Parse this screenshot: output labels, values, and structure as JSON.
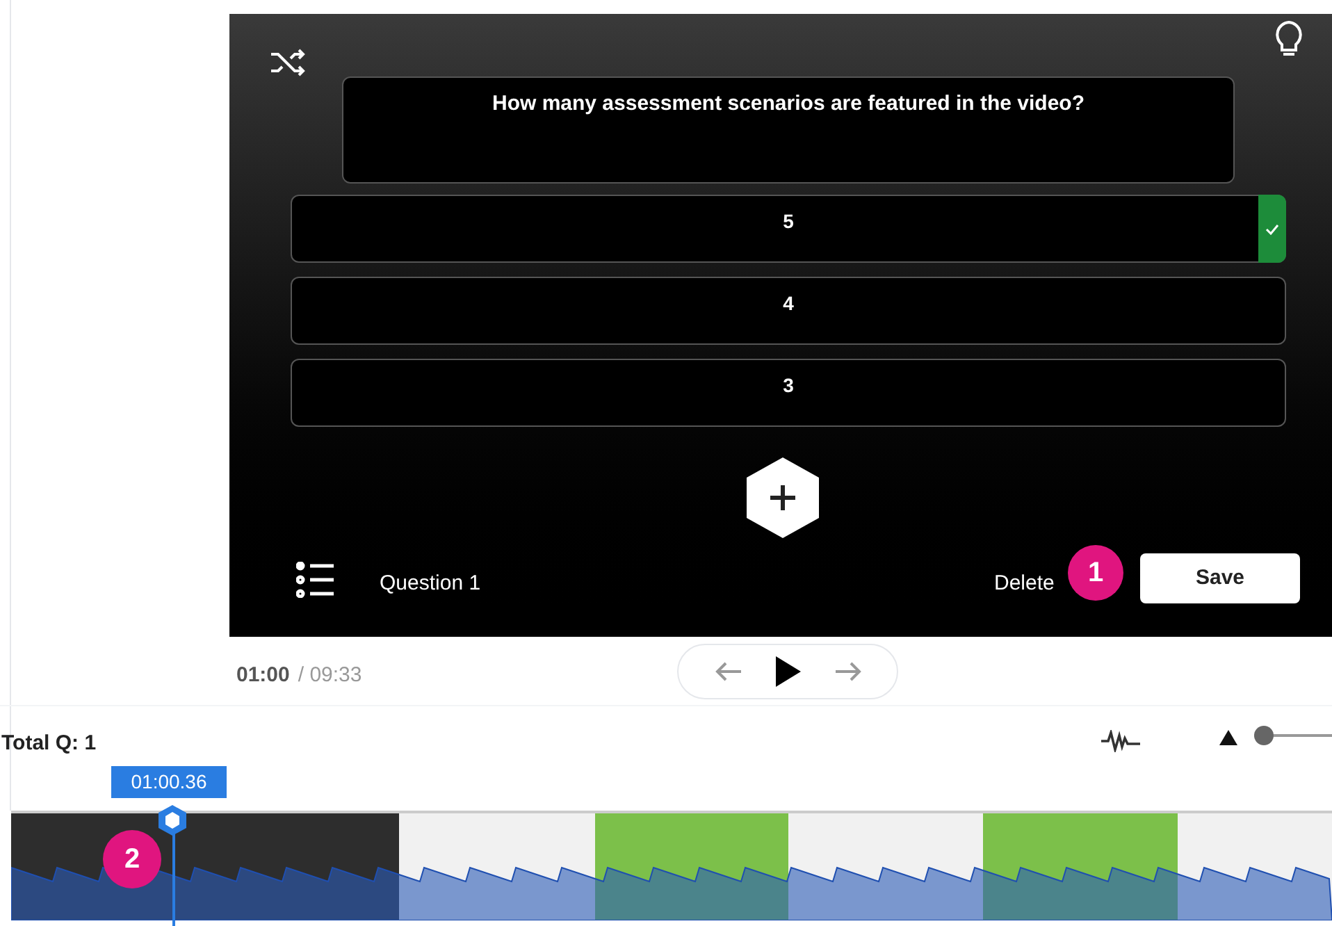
{
  "question": {
    "text": "How many assessment scenarios are featured in the video?"
  },
  "answers": [
    {
      "text": "5",
      "selected": true
    },
    {
      "text": "4",
      "selected": false
    },
    {
      "text": "3",
      "selected": false
    }
  ],
  "editor_bar": {
    "label": "Question 1",
    "delete": "Delete",
    "save": "Save"
  },
  "player": {
    "current": "01:00",
    "total": "/ 09:33"
  },
  "timeline": {
    "total_q": "Total Q: 1",
    "playhead_time": "01:00.36",
    "zoom": {
      "level": 0
    }
  },
  "callouts": [
    "1",
    "2"
  ]
}
